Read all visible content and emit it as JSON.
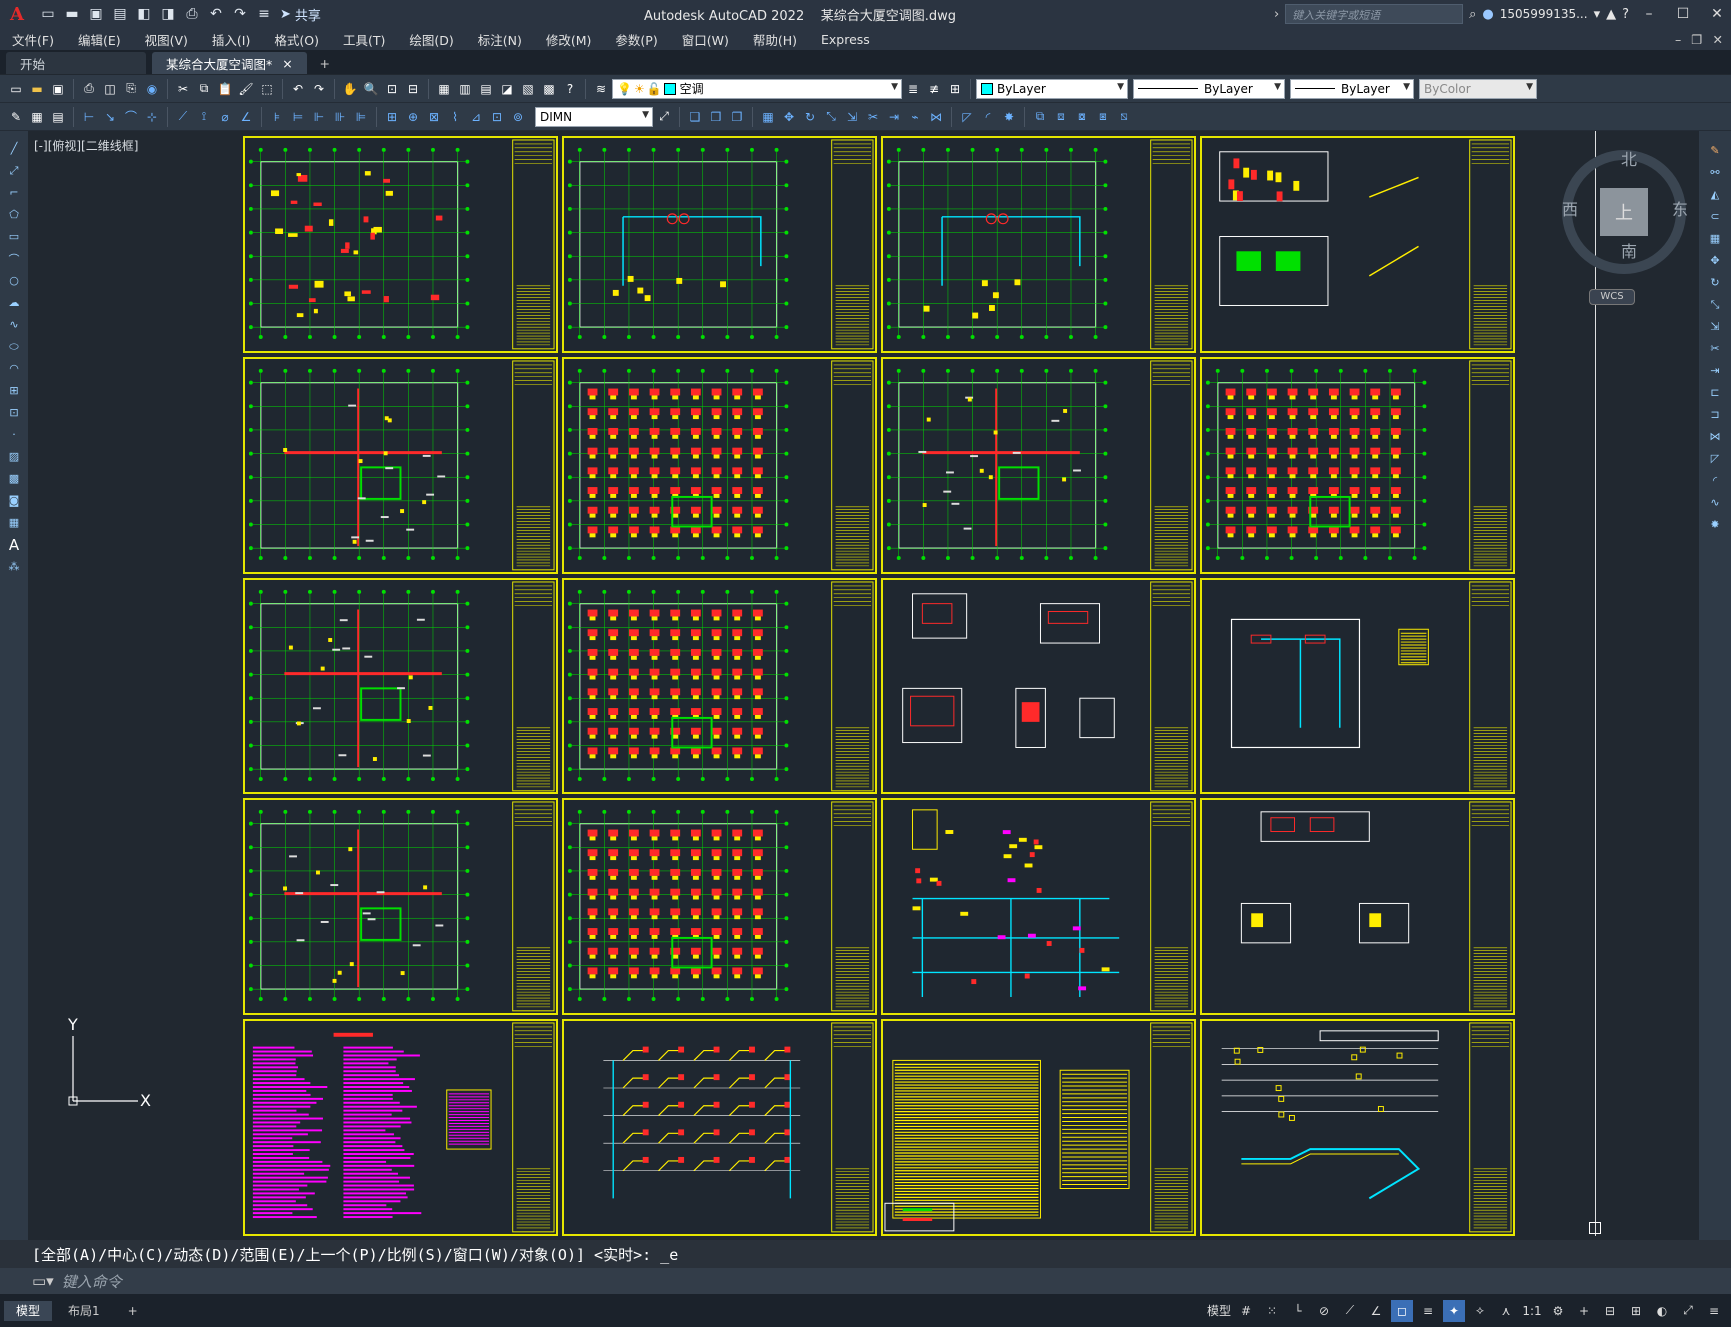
{
  "titlebar": {
    "app_title": "Autodesk AutoCAD 2022",
    "doc_title": "某综合大厦空调图.dwg",
    "share_label": "共享",
    "search_placeholder": "键入关键字或短语",
    "user": "1505999135...",
    "logo": "A"
  },
  "menu": {
    "items": [
      "文件(F)",
      "编辑(E)",
      "视图(V)",
      "插入(I)",
      "格式(O)",
      "工具(T)",
      "绘图(D)",
      "标注(N)",
      "修改(M)",
      "参数(P)",
      "窗口(W)",
      "帮助(H)",
      "Express"
    ]
  },
  "tabs": {
    "start": "开始",
    "active": "某综合大厦空调图*",
    "close": "×",
    "add": "+"
  },
  "toolbar1": {
    "layer": "空调",
    "color": "ByLayer",
    "linetype": "ByLayer",
    "lineweight": "ByLayer",
    "plotstyle": "ByColor"
  },
  "toolbar2": {
    "dimstyle": "DIMN"
  },
  "viewport": {
    "label": "[-][俯视][二维线框]",
    "compass": {
      "north": "北",
      "south": "南",
      "west": "西",
      "east": "东",
      "top": "上"
    },
    "wcs": "WCS",
    "ucs_x": "X",
    "ucs_y": "Y"
  },
  "command": {
    "history": "[全部(A)/中心(C)/动态(D)/范围(E)/上一个(P)/比例(S)/窗口(W)/对象(O)] <实时>: _e",
    "placeholder": "键入命令"
  },
  "status": {
    "model_tab": "模型",
    "layout_tab": "布局1",
    "add": "+",
    "model_btn": "模型",
    "scale": "1:1"
  },
  "colors": {
    "frame": "#e6e600",
    "grid": "#00e000",
    "hvac_red": "#ff2a2a",
    "hvac_yellow": "#ffee00",
    "cyan": "#00e5ff",
    "magenta": "#ff00ff"
  },
  "sheets": [
    {
      "type": "plan"
    },
    {
      "type": "plan-sparse"
    },
    {
      "type": "plan-sparse"
    },
    {
      "type": "detail"
    },
    {
      "type": "plan-rooms"
    },
    {
      "type": "plan-dense"
    },
    {
      "type": "plan-rooms"
    },
    {
      "type": "plan-dense"
    },
    {
      "type": "plan-rooms"
    },
    {
      "type": "plan-dense"
    },
    {
      "type": "details-multi"
    },
    {
      "type": "room-detail"
    },
    {
      "type": "plan-rooms"
    },
    {
      "type": "plan-dense"
    },
    {
      "type": "schematic"
    },
    {
      "type": "elevations"
    },
    {
      "type": "notes"
    },
    {
      "type": "riser"
    },
    {
      "type": "table"
    },
    {
      "type": "sections"
    }
  ]
}
